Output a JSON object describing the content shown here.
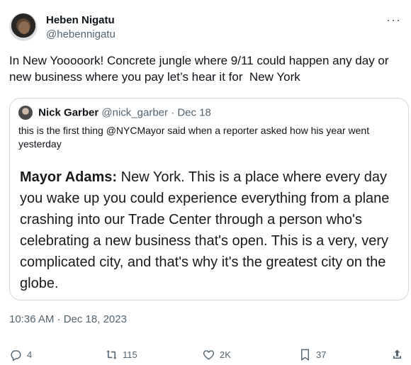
{
  "author": {
    "display_name": "Heben Nigatu",
    "handle": "@hebennigatu"
  },
  "more_label": "···",
  "tweet_text": "In New Yooooork! Concrete jungle where 9/11 could happen any day or new business where you pay let’s hear it for  New York",
  "quote": {
    "display_name": "Nick Garber",
    "handle": "@nick_garber",
    "separator": "·",
    "date": "Dec 18",
    "text": "this is the first thing @NYCMayor said when a reporter asked how his year went yesterday",
    "media_speaker": "Mayor Adams:",
    "media_text": " New York. This is a place where every day you wake up you could experience everything from a plane crashing into our Trade Center through a person who's celebrating a new business that's open. This is a very, very complicated city, and that's why it's the greatest city on the globe."
  },
  "timestamp": "10:36 AM · Dec 18, 2023",
  "actions": {
    "replies": "4",
    "reposts": "115",
    "likes": "2K",
    "bookmarks": "37"
  },
  "icons": [
    "reply-icon",
    "repost-icon",
    "like-icon",
    "bookmark-icon",
    "share-icon"
  ],
  "colors": {
    "text": "#0f1419",
    "secondary": "#536471",
    "border": "#cfd9de"
  }
}
